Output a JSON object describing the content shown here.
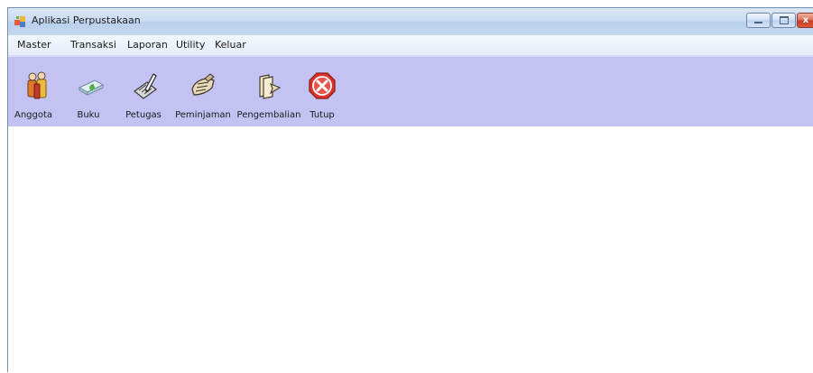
{
  "window": {
    "title": "Aplikasi Perpustakaan",
    "app_icon": "app-window-icon"
  },
  "caption_buttons": {
    "minimize": "minimize-icon",
    "maximize": "maximize-icon",
    "close": "close-icon",
    "close_glyph": "x"
  },
  "menu": {
    "items": [
      {
        "label": "Master"
      },
      {
        "label": "Transaksi"
      },
      {
        "label": "Laporan"
      },
      {
        "label": "Utility"
      },
      {
        "label": "Keluar"
      }
    ]
  },
  "toolbar": {
    "background": "#c4c2f3",
    "buttons": [
      {
        "label": "Anggota",
        "icon": "members-icon"
      },
      {
        "label": "Buku",
        "icon": "book-icon"
      },
      {
        "label": "Petugas",
        "icon": "staff-icon"
      },
      {
        "label": "Peminjaman",
        "icon": "borrow-icon"
      },
      {
        "label": "Pengembalian",
        "icon": "return-icon"
      },
      {
        "label": "Tutup",
        "icon": "close-app-icon"
      }
    ]
  },
  "colors": {
    "close_red": "#d9332a",
    "menubar": "#e9eff8",
    "titlebar": "#c9dcf2"
  }
}
